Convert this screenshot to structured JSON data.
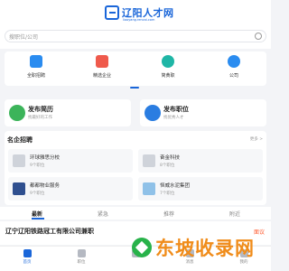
{
  "header": {
    "logo_text": "辽阳人才网",
    "logo_sub": "liaoyang.rencai.com",
    "search_placeholder": "搜职位/公司"
  },
  "quick_menu": [
    {
      "label": "全职招聘",
      "icon": "briefcase-icon",
      "color": "#2a8cf0"
    },
    {
      "label": "精选企业",
      "icon": "building-icon",
      "color": "#ef5a4c"
    },
    {
      "label": "简黄职",
      "icon": "clock-icon",
      "color": "#1fb6a6"
    },
    {
      "label": "公司",
      "icon": "user-icon",
      "color": "#2a8cf0"
    }
  ],
  "publish": [
    {
      "title": "发布简历",
      "sub": "找最好的工作",
      "icon": "resume-icon",
      "color": "#3cb45a"
    },
    {
      "title": "发布职位",
      "sub": "找优秀人才",
      "icon": "job-post-icon",
      "color": "#2a7de1"
    }
  ],
  "famous": {
    "title": "名企招聘",
    "more": "更多 >",
    "companies": [
      {
        "name": "环球雅思分校",
        "count": "9个职位",
        "logo_color": "#cfd3da"
      },
      {
        "name": "奋金科技",
        "count": "8个职位",
        "logo_color": "#cfd3da"
      },
      {
        "name": "都都物业服务",
        "count": "9个职位",
        "logo_color": "#2f4f8f"
      },
      {
        "name": "恒威水泥集团",
        "count": "7个职位",
        "logo_color": "#8fc1e8"
      }
    ]
  },
  "tabs": [
    "最新",
    "紧急",
    "推荐",
    "附近"
  ],
  "job": {
    "title": "辽宁辽阳铁路冠工有限公司兼职",
    "salary": "面议"
  },
  "nav": [
    "首页",
    "职位",
    "",
    "消息",
    "我的"
  ],
  "watermark": "东坡收录网"
}
